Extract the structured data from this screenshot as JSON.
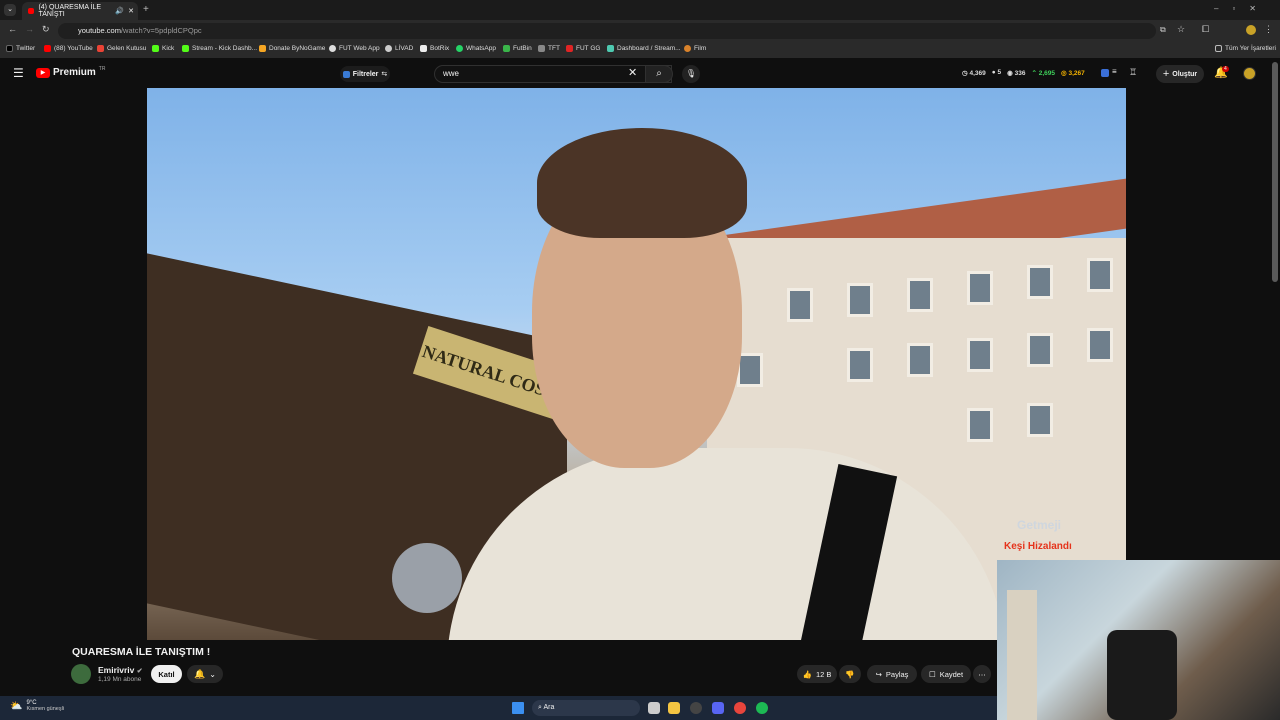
{
  "browser": {
    "tab_title": "(4) QUARESMA İLE TANIŞTI",
    "url_host": "youtube.com",
    "url_path": "/watch?v=5pdpldCPQpc",
    "bookmarks": [
      "Twitter",
      "(88) YouTube",
      "Gelen Kutusu",
      "Kick",
      "Stream - Kick Dashb...",
      "Donate ByNoGame",
      "FUT Web App",
      "LİVAD",
      "BotRix",
      "WhatsApp",
      "FutBin",
      "TFT",
      "FUT GG",
      "Dashboard / Stream...",
      "Film"
    ],
    "all_bookmarks": "Tüm Yer İşaretleri"
  },
  "header": {
    "premium_label": "Premium",
    "premium_badge": "TR",
    "filters_label": "Filtreler",
    "search_value": "wwe",
    "stats": [
      "4,369",
      "5",
      "336",
      "2,695",
      "3,267"
    ],
    "create_label": "Oluştur",
    "notif_count": "4"
  },
  "video": {
    "sign_text": "NATURAL COSM",
    "title": "QUARESMA İLE TANIŞTIM !",
    "channel": "Emirivriv",
    "subscribers": "1,19 Mn abone",
    "join_label": "Katıl",
    "likes": "12 B",
    "share_label": "Paylaş",
    "save_label": "Kaydet"
  },
  "overlay": {
    "logo_text": "Getmeji",
    "logo_sub": "Keşi Hizalandı"
  },
  "taskbar": {
    "temperature": "9°C",
    "weather": "Kısmen güneşli",
    "search_placeholder": "Ara"
  },
  "colors": {
    "youtube_red": "#ff0000",
    "bg": "#0f0f0f",
    "pill": "#272727"
  }
}
